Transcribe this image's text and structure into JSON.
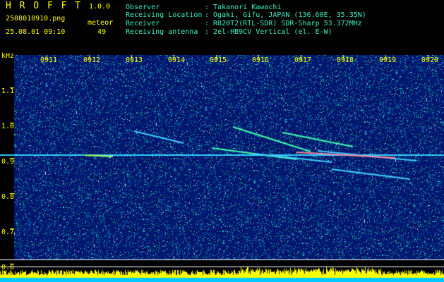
{
  "app": {
    "name": "H R O F F T",
    "version": "1.0.0"
  },
  "capture": {
    "filename": "2508010910.png",
    "datetime": "25.08.01 09:10",
    "meteor_label": "meteor",
    "meteor_count": "49"
  },
  "info": [
    {
      "label": "Observer",
      "value": ": Takanori Kawachi"
    },
    {
      "label": "Receiving Location",
      "value": ": Ogaki, Gifu, JAPAN (136.60E, 35.35N)"
    },
    {
      "label": "Receiver",
      "value": ": R820T2(RTL-SDR) SDR-Sharp 53.372MHz"
    },
    {
      "label": "Receiving antenna",
      "value": ": 2el-HB9CV Vertical (el. E-W)"
    }
  ],
  "axis": {
    "unit": "kHz",
    "time_ticks": [
      "0911",
      "0912",
      "0913",
      "0914",
      "0915",
      "0916",
      "0917",
      "0918",
      "0919",
      "0920"
    ],
    "freq_ticks": [
      "1.1",
      "1.0",
      "0.9",
      "0.8",
      "0.7",
      "0.6"
    ]
  },
  "colors": {
    "background": "#000000",
    "spectrogram_base": "#0a0a70",
    "header_yellow": "#ffff00",
    "header_cyan": "#3cf0c8",
    "carrier": "#20c8ff",
    "meteor_echo": "#40ffb0",
    "level_bars": "#ffff00",
    "level_base": "#00c8ff"
  }
}
